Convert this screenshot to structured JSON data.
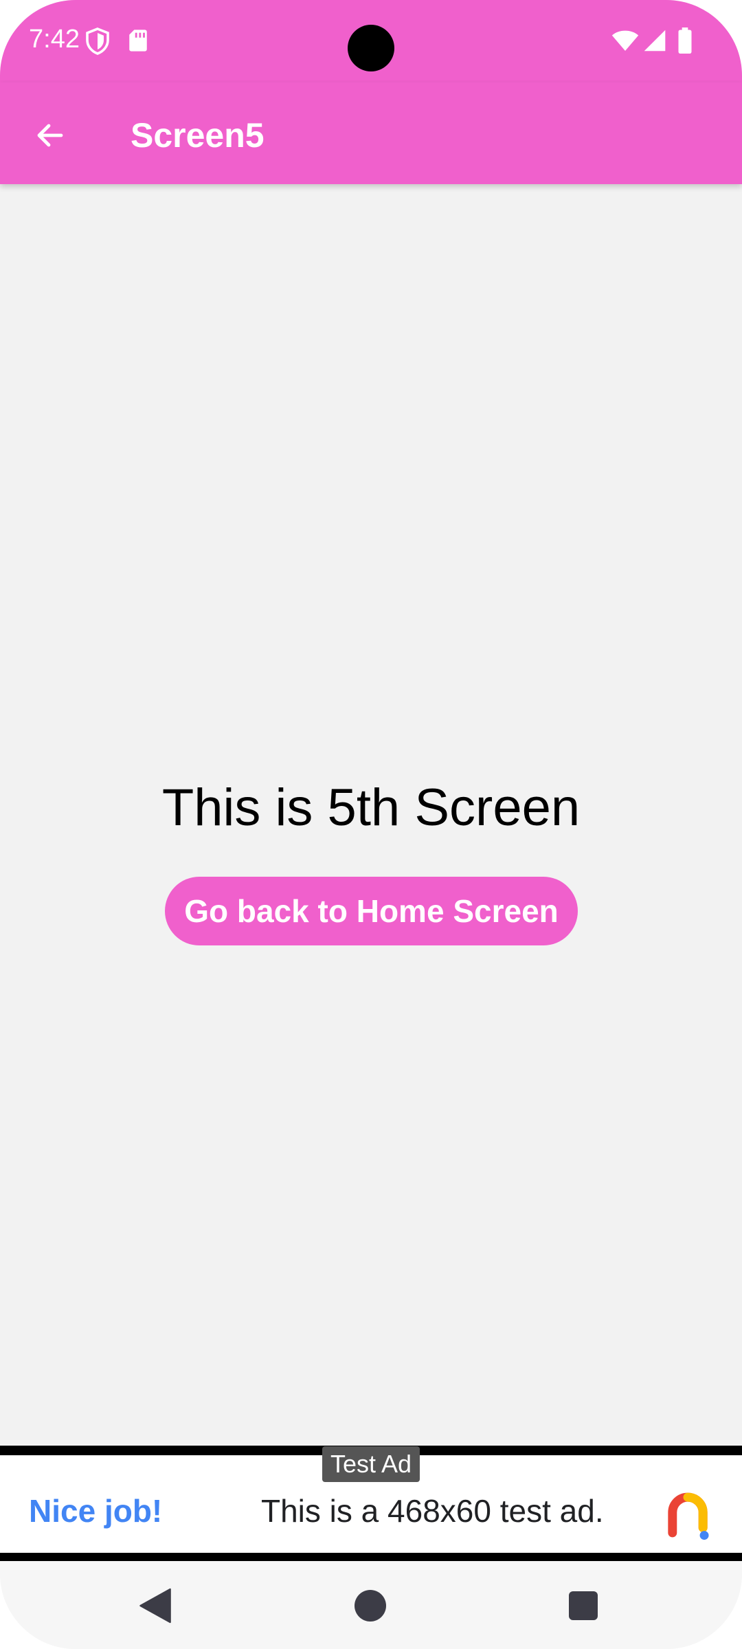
{
  "status_bar": {
    "time": "7:42",
    "icons": [
      "shield-icon",
      "sd-card-icon",
      "wifi-icon",
      "signal-icon",
      "battery-icon"
    ]
  },
  "app_bar": {
    "title": "Screen5",
    "back_icon": "arrow-back-icon",
    "color": "#f060cc"
  },
  "main": {
    "heading": "This is 5th Screen",
    "button_label": "Go back to Home Screen"
  },
  "ad": {
    "label": "Test Ad",
    "headline": "Nice job!",
    "text": "This is a 468x60 test ad.",
    "headline_color": "#4285f4"
  },
  "nav_bar": {
    "icons": [
      "nav-back-icon",
      "nav-home-icon",
      "nav-recents-icon"
    ]
  }
}
